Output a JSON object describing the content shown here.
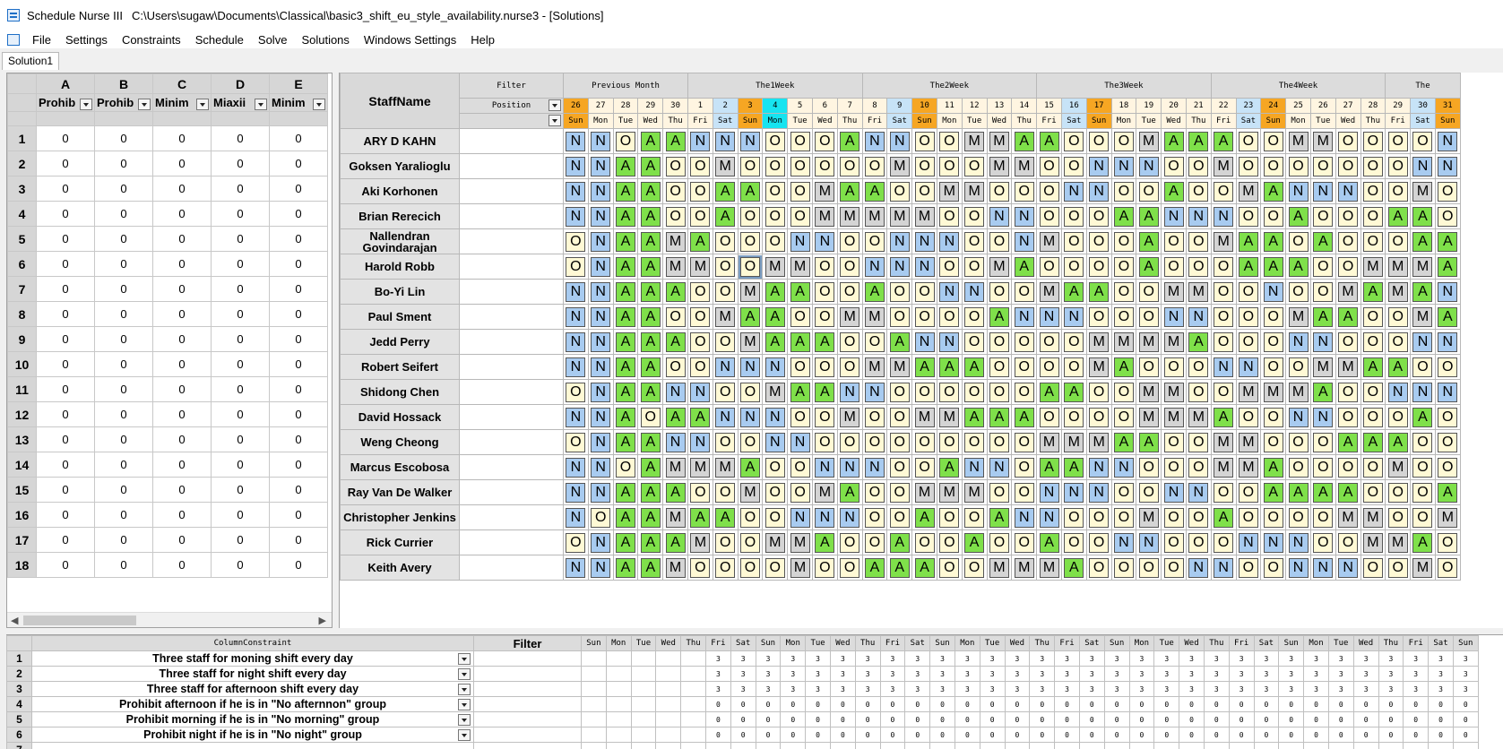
{
  "window": {
    "app_title": "Schedule Nurse III",
    "file_path": "C:\\Users\\sugaw\\Documents\\Classical\\basic3_shift_eu_style_availability.nurse3 - [Solutions]"
  },
  "menu": [
    "File",
    "Settings",
    "Constraints",
    "Schedule",
    "Solve",
    "Solutions",
    "Windows Settings",
    "Help"
  ],
  "tab": {
    "label": "Solution1"
  },
  "left_grid": {
    "columns": [
      {
        "letter": "A",
        "label": "Prohib"
      },
      {
        "letter": "B",
        "label": "Prohib"
      },
      {
        "letter": "C",
        "label": "Minim"
      },
      {
        "letter": "D",
        "label": "Miaxii"
      },
      {
        "letter": "E",
        "label": "Minim"
      }
    ],
    "row_numbers": [
      "1",
      "2",
      "3",
      "4",
      "5",
      "6",
      "7",
      "8",
      "9",
      "10",
      "11",
      "12",
      "13",
      "14",
      "15",
      "16",
      "17",
      "18"
    ],
    "cell_value": "0"
  },
  "roster": {
    "staff_header": "StaffName",
    "filter_label": "Filter",
    "position_label": "Position",
    "week_groups": [
      {
        "label": "Previous Month",
        "span": 5
      },
      {
        "label": "The1Week",
        "span": 7
      },
      {
        "label": "The2Week",
        "span": 7
      },
      {
        "label": "The3Week",
        "span": 7
      },
      {
        "label": "The4Week",
        "span": 7
      },
      {
        "label": "The",
        "span": 3
      }
    ],
    "days": [
      {
        "d": "26",
        "w": "Sun",
        "bg": "sun"
      },
      {
        "d": "27",
        "w": "Mon",
        "bg": "wk"
      },
      {
        "d": "28",
        "w": "Tue",
        "bg": "wk"
      },
      {
        "d": "29",
        "w": "Wed",
        "bg": "wk"
      },
      {
        "d": "30",
        "w": "Thu",
        "bg": "wk"
      },
      {
        "d": "1",
        "w": "Fri",
        "bg": "wk"
      },
      {
        "d": "2",
        "w": "Sat",
        "bg": "sat"
      },
      {
        "d": "3",
        "w": "Sun",
        "bg": "sun"
      },
      {
        "d": "4",
        "w": "Mon",
        "bg": "monhi"
      },
      {
        "d": "5",
        "w": "Tue",
        "bg": "wk"
      },
      {
        "d": "6",
        "w": "Wed",
        "bg": "wk"
      },
      {
        "d": "7",
        "w": "Thu",
        "bg": "wk"
      },
      {
        "d": "8",
        "w": "Fri",
        "bg": "wk"
      },
      {
        "d": "9",
        "w": "Sat",
        "bg": "sat"
      },
      {
        "d": "10",
        "w": "Sun",
        "bg": "sun"
      },
      {
        "d": "11",
        "w": "Mon",
        "bg": "wk"
      },
      {
        "d": "12",
        "w": "Tue",
        "bg": "wk"
      },
      {
        "d": "13",
        "w": "Wed",
        "bg": "wk"
      },
      {
        "d": "14",
        "w": "Thu",
        "bg": "wk"
      },
      {
        "d": "15",
        "w": "Fri",
        "bg": "wk"
      },
      {
        "d": "16",
        "w": "Sat",
        "bg": "sat"
      },
      {
        "d": "17",
        "w": "Sun",
        "bg": "sun"
      },
      {
        "d": "18",
        "w": "Mon",
        "bg": "wk"
      },
      {
        "d": "19",
        "w": "Tue",
        "bg": "wk"
      },
      {
        "d": "20",
        "w": "Wed",
        "bg": "wk"
      },
      {
        "d": "21",
        "w": "Thu",
        "bg": "wk"
      },
      {
        "d": "22",
        "w": "Fri",
        "bg": "wk"
      },
      {
        "d": "23",
        "w": "Sat",
        "bg": "sat"
      },
      {
        "d": "24",
        "w": "Sun",
        "bg": "sun"
      },
      {
        "d": "25",
        "w": "Mon",
        "bg": "wk"
      },
      {
        "d": "26",
        "w": "Tue",
        "bg": "wk"
      },
      {
        "d": "27",
        "w": "Wed",
        "bg": "wk"
      },
      {
        "d": "28",
        "w": "Thu",
        "bg": "wk"
      },
      {
        "d": "29",
        "w": "Fri",
        "bg": "wk"
      },
      {
        "d": "30",
        "w": "Sat",
        "bg": "sat"
      },
      {
        "d": "31",
        "w": "Sun",
        "bg": "sun"
      }
    ],
    "staff": [
      {
        "name": "ARY D KAHN",
        "shifts": "NNOAANNNOOOANNOOMMAAOOOMAAAOOMMOOOON"
      },
      {
        "name": "Goksen Yaralioglu",
        "shifts": "NNAAOOMOOOOOOMOOOMMOONNNOOMOOOOOOONN"
      },
      {
        "name": "Aki Korhonen",
        "shifts": "NNAAOOAAOOMAAOOMMOOONNOOAOOMANNNOOM"
      },
      {
        "name": "Brian Rerecich",
        "shifts": "NNAAOOAOOOMMMMMOONNOOOAANNNOOAOOOAAOM"
      },
      {
        "name": "Nallendran Govindarajan",
        "shifts": "ONAAMAOOONNOONNNOONMOOOAOOMAAOAOOOAAO"
      },
      {
        "name": "Harold Robb",
        "shifts": "ONAAMMOOMMOONNNOOMAOOOOAOOOAAAOOMMMA"
      },
      {
        "name": "Bo-Yi Lin",
        "shifts": "NNAAAOOMAAOOAOONNOOMAAOOMMOONOOMAMANON"
      },
      {
        "name": "Paul Sment",
        "shifts": "NNAAOOMAAOOMMOOOOANNNOOONNOOOMAAOOMA"
      },
      {
        "name": "Jedd Perry",
        "shifts": "NNAAAOOMAAAOOANNOOOOOMMMMAOOONNOOONNOO"
      },
      {
        "name": "Robert Seifert",
        "shifts": "NNAAOONNNOOOMMAAAOOOOMAOOONNOOMMAAOO"
      },
      {
        "name": "Shidong Chen",
        "shifts": "ONAANNOOMAANNOOOOOOAAOOMMOOMMMAOONNNO"
      },
      {
        "name": "David Hossack",
        "shifts": "NNAOAANNNOOMOOMMAAAOOOOMMMAOONNOOOAO"
      },
      {
        "name": "Weng Cheong",
        "shifts": "ONAANNOONNOOOOOOOOOMMMAAOOMMOOOAAAOOO"
      },
      {
        "name": "Marcus Escobosa",
        "shifts": "NNOAMMMAOONNNOOANNOAANNOOOMMAOOOOMOO"
      },
      {
        "name": "Ray Van De Walker",
        "shifts": "NNAAAOOMOOMAOOMMMOONNNOONNOOAAAAOOOA"
      },
      {
        "name": "Christopher Jenkins",
        "shifts": "NOAAMAAOONNNOOAOOANNOOOMOOAOOOOMMOOMM"
      },
      {
        "name": "Rick Currier",
        "shifts": "ONAAAMOOMMAOOAOOAOOAOONNOOONNNOOMMAO"
      },
      {
        "name": "Keith Avery",
        "shifts": "NNAAMOOOOMOOAAAOOMMMAOOOONNOONNNOOM"
      }
    ]
  },
  "bottom": {
    "header": "ColumnConstraint",
    "filter_label": "Filter",
    "weekdays": [
      "Sun",
      "Mon",
      "Tue",
      "Wed",
      "Thu",
      "Fri",
      "Sat",
      "Sun",
      "Mon",
      "Tue",
      "Wed",
      "Thu",
      "Fri",
      "Sat",
      "Sun",
      "Mon",
      "Tue",
      "Wed",
      "Thu",
      "Fri",
      "Sat",
      "Sun",
      "Mon",
      "Tue",
      "Wed",
      "Thu",
      "Fri",
      "Sat",
      "Sun",
      "Mon",
      "Tue",
      "Wed",
      "Thu",
      "Fri",
      "Sat",
      "Sun"
    ],
    "rows": [
      {
        "num": "1",
        "name": "Three staff for moning shift every day",
        "value": "3"
      },
      {
        "num": "2",
        "name": "Three staff for night shift every day",
        "value": "3"
      },
      {
        "num": "3",
        "name": "Three staff for afternoon shift every day",
        "value": "3"
      },
      {
        "num": "4",
        "name": "Prohibit afternoon if he is in \"No afternnon\" group",
        "value": "0"
      },
      {
        "num": "5",
        "name": "Prohibit morning if he is in \"No morning\" group",
        "value": "0"
      },
      {
        "num": "6",
        "name": "Prohibit night if he is in \"No night\" group",
        "value": "0"
      }
    ],
    "partial_row_num": "7"
  },
  "colors": {
    "night": "#a8cbf0",
    "off": "#fff9d5",
    "afternoon": "#7fe04a",
    "morning": "#d4d4d4",
    "sunday": "#f6a623",
    "saturday": "#c7e3f7",
    "highlight_monday": "#17e4f0"
  }
}
